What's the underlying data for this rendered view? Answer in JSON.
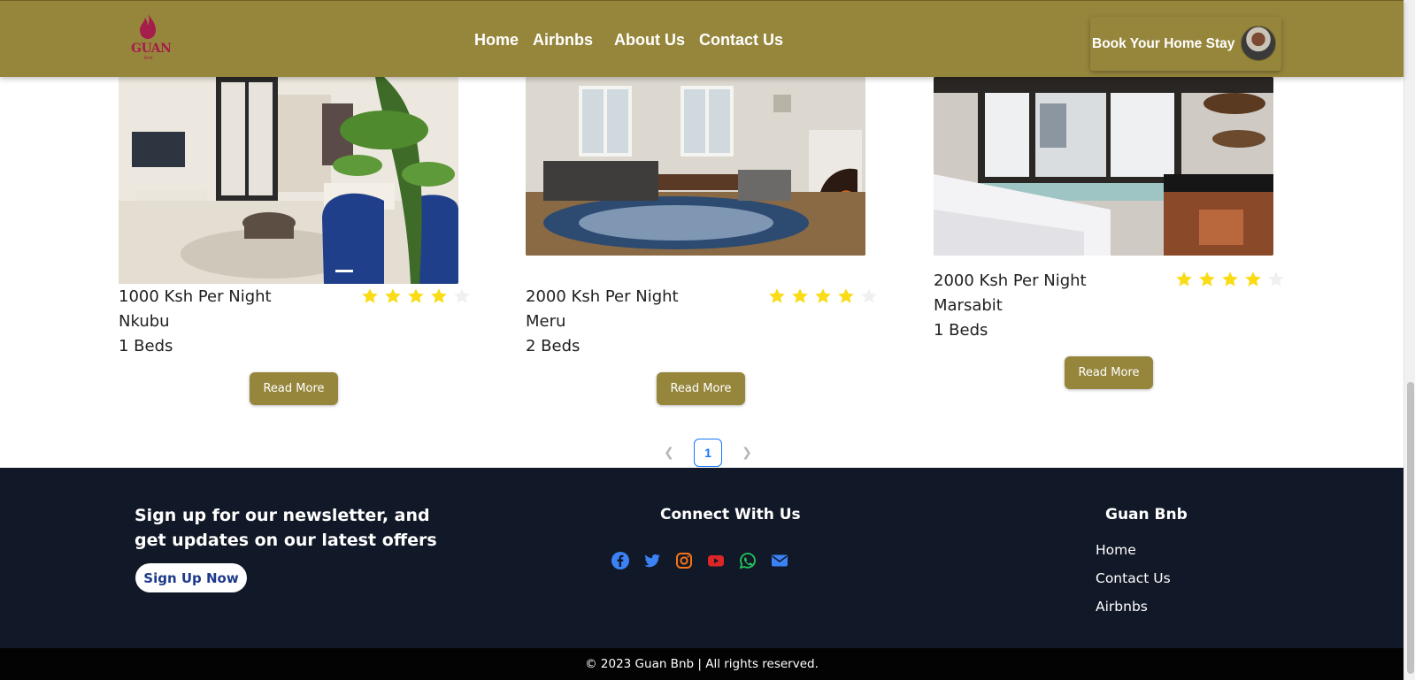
{
  "header": {
    "logo_text": "GUAN",
    "logo_subtext": "bnb",
    "nav": [
      "Home",
      "Airbnbs",
      "About Us",
      "Contact Us"
    ],
    "book_button": "Book Your Home Stay",
    "colors": {
      "header_bg": "#96863c",
      "brand": "#a51d4a"
    }
  },
  "listings": [
    {
      "price": "1000 Ksh Per Night",
      "location": "Nkubu",
      "beds": "1 Beds",
      "rating": 4,
      "max_rating": 5,
      "button": "Read More"
    },
    {
      "price": "2000 Ksh Per Night",
      "location": "Meru",
      "beds": "2 Beds",
      "rating": 4,
      "max_rating": 5,
      "button": "Read More"
    },
    {
      "price": "2000 Ksh Per Night",
      "location": "Marsabit",
      "beds": "1 Beds",
      "rating": 4,
      "max_rating": 5,
      "button": "Read More"
    }
  ],
  "pagination": {
    "current": "1",
    "prev_icon": "chevron-left-icon",
    "next_icon": "chevron-right-icon"
  },
  "footer": {
    "newsletter_title": "Sign up for our newsletter, and get updates on our latest offers",
    "signup_button": "Sign Up Now",
    "connect_title": "Connect With Us",
    "social_icons": [
      "facebook-icon",
      "twitter-icon",
      "instagram-icon",
      "youtube-icon",
      "whatsapp-icon",
      "email-icon"
    ],
    "brand_title": "Guan Bnb",
    "links": [
      "Home",
      "Contact Us",
      "Airbnbs"
    ],
    "colors": {
      "footer_bg": "#111827",
      "star": "#fadb14"
    }
  },
  "copyright": "© 2023 Guan Bnb | All rights reserved."
}
